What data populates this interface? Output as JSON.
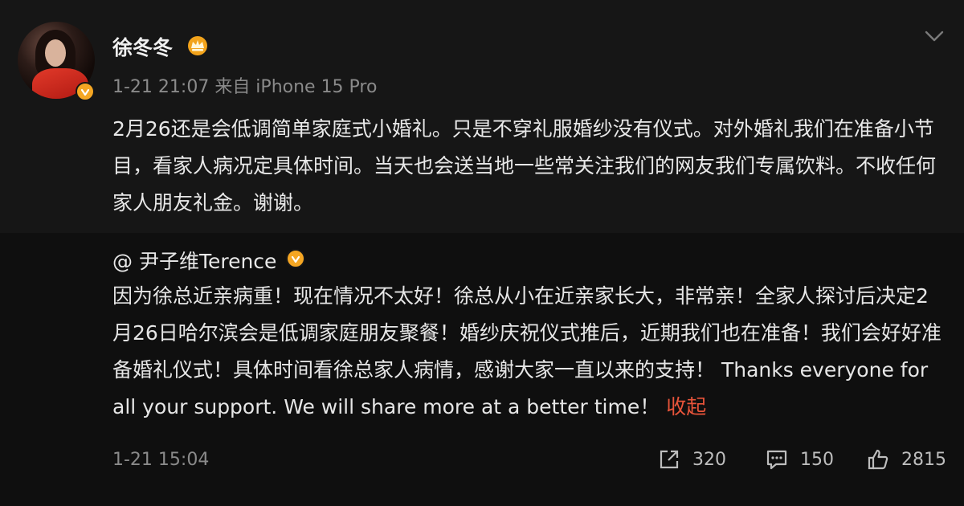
{
  "post": {
    "username": "徐冬冬",
    "meta": "1-21 21:07  来自 iPhone 15 Pro",
    "body": "2月26还是会低调简单家庭式小婚礼。只是不穿礼服婚纱没有仪式。对外婚礼我们在准备小节目，看家人病况定具体时间。当天也会送当地一些常关注我们的网友我们专属饮料。不收任何家人朋友礼金。谢谢。"
  },
  "repost": {
    "name": "@ 尹子维Terence",
    "text": "因为徐总近亲病重！现在情况不太好！徐总从小在近亲家长大，非常亲！全家人探讨后决定2月26日哈尔滨会是低调家庭朋友聚餐！婚纱庆祝仪式推后，近期我们也在准备！我们会好好准备婚礼仪式！具体时间看徐总家人病情，感谢大家一直以来的支持！ Thanks everyone for all your support.  We will share more at a better time！",
    "collapse_label": "收起"
  },
  "footer": {
    "time": "1-21 15:04",
    "share_count": "320",
    "comment_count": "150",
    "like_count": "2815"
  },
  "colors": {
    "verified": "#f5a623",
    "link": "#e8543a"
  }
}
